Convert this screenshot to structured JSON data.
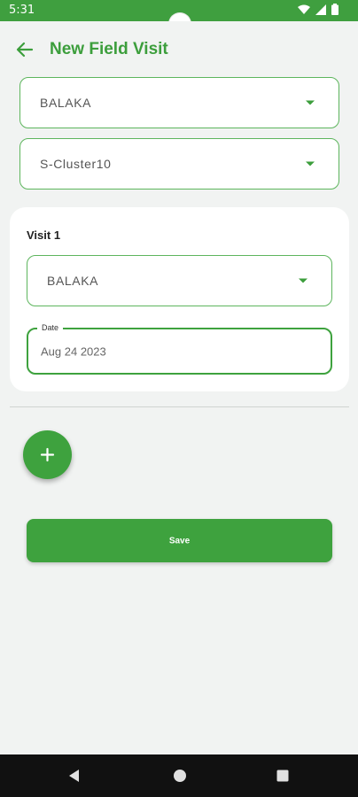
{
  "status_bar": {
    "time": "5:31"
  },
  "app_bar": {
    "title": "New Field Visit"
  },
  "form": {
    "district_select": {
      "value": "BALAKA"
    },
    "cluster_select": {
      "value": "S-Cluster10"
    }
  },
  "visit_card": {
    "title": "Visit 1",
    "location_select": {
      "value": "BALAKA"
    },
    "date_field": {
      "label": "Date",
      "value": "Aug 24 2023"
    }
  },
  "save_button": {
    "label": "Save"
  },
  "colors": {
    "accent": "#3ea23e",
    "status_bar": "#3f9f3f",
    "background": "#f1f3f2"
  }
}
